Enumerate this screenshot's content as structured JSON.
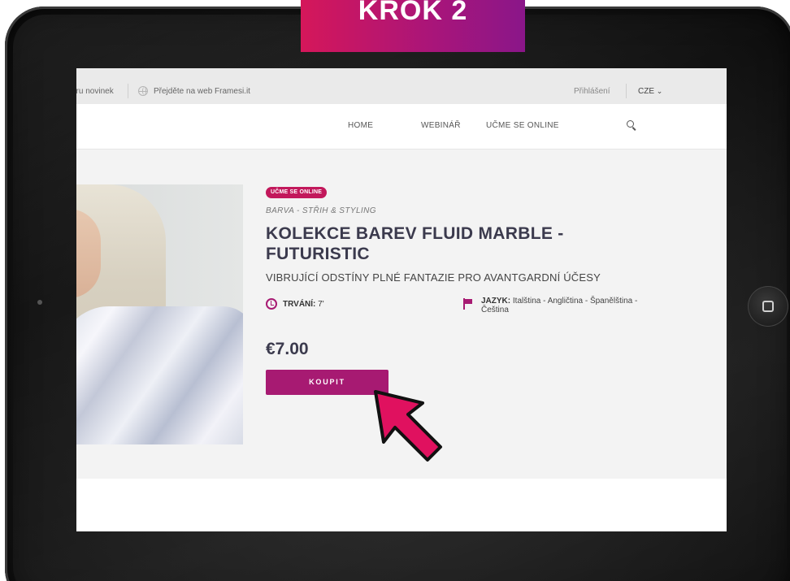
{
  "banner": {
    "step_label": "KROK 2"
  },
  "topbar": {
    "newsletter_link": "ěru novinek",
    "site_link": "Přejděte na web Framesi.it",
    "login_link": "Přihlášení",
    "language": "CZE",
    "language_chevron": "⌄"
  },
  "nav": {
    "items": [
      {
        "label": "HOME"
      },
      {
        "label": "WEBINÁŘ"
      },
      {
        "label": "UČME SE ONLINE"
      }
    ],
    "search_icon": "search-icon"
  },
  "product": {
    "badge": "UČME SE ONLINE",
    "category": "BARVA - STŘIH & STYLING",
    "title": "KOLEKCE BAREV FLUID MARBLE - FUTURISTIC",
    "subtitle": "VIBRUJÍCÍ ODSTÍNY PLNÉ FANTAZIE PRO AVANTGARDNÍ ÚČESY",
    "duration_label": "TRVÁNÍ:",
    "duration_value": "7'",
    "language_label": "JAZYK:",
    "languages": "Italština - Angličtina - Španělština - Čeština",
    "price": "€7.00",
    "buy_button": "KOUPIT"
  },
  "colors": {
    "accent": "#a71a72",
    "badge": "#c2185b",
    "title": "#3b3a4d",
    "banner_start": "#d5175a",
    "banner_end": "#8a1689",
    "cursor": "#e0115f"
  }
}
